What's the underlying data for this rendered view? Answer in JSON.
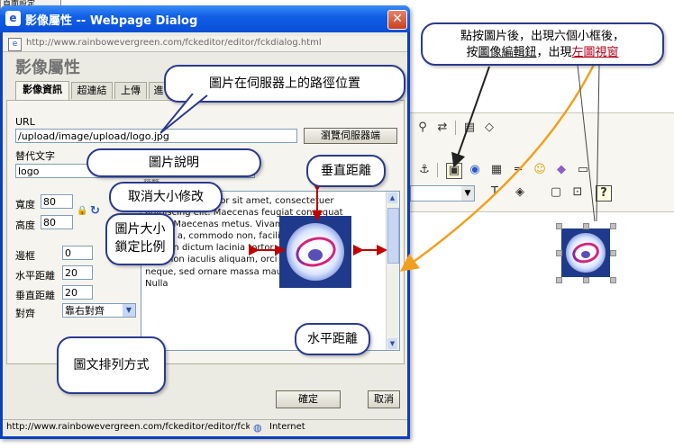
{
  "background": {
    "tab_label": "頁面設定",
    "toolbar_row1_icons": [
      "binoculars-icon",
      "replace-icon",
      "select-all-icon",
      "eraser-icon"
    ],
    "toolbar_row2_icons": [
      "anchor-icon",
      "image-icon",
      "flash-icon",
      "table-icon",
      "horizontal-rule-icon",
      "smiley-icon",
      "special-char-icon",
      "page-break-icon"
    ],
    "toolbar_row3_icons": [
      "text-color-icon",
      "background-color-icon",
      "maximize-icon",
      "preview-icon",
      "about-icon"
    ]
  },
  "dialog": {
    "title": "影像屬性 -- Webpage Dialog",
    "close_glyph": "✕",
    "address": "http://www.rainbowevergreen.com/fckeditor/editor/fckdialog.html",
    "heading": "影像屬性",
    "tabs": [
      "影像資訊",
      "超連結",
      "上傳",
      "進"
    ],
    "url_label": "URL",
    "url_value": "/upload/image/upload/logo.jpg",
    "browse_button": "瀏覽伺服器端",
    "alt_label": "替代文字",
    "alt_value": "logo",
    "width_label": "寬度",
    "width_value": "80",
    "height_label": "高度",
    "height_value": "80",
    "border_label": "邊框",
    "border_value": "0",
    "hspace_label": "水平距離",
    "hspace_value": "20",
    "vspace_label": "垂直距離",
    "vspace_value": "20",
    "align_label": "對齊",
    "align_value": "靠右對齊",
    "preview_label": "預覽",
    "preview_text": "Lorem ipsum dolor sit amet, consectetuer adipiscing elit. Maecenas feugiat consequat diam. Maecenas metus. Vivamus diam purus, cursus a, commodo non, facilisis vitae, nulla. Aenean dictum lacinia tortor. Nunc iaculis, nibh non iaculis aliquam, orci felis euismod neque, sed ornare massa mauris sed velit. Nulla",
    "ok_button": "確定",
    "cancel_button": "取消",
    "status_url": "http://www.rainbowevergreen.com/fckeditor/editor/fckd",
    "status_zone": "Internet"
  },
  "callouts": {
    "path": "圖片在伺服器上的路徑位置",
    "alt": "圖片說明",
    "reset_size": "取消大小修改",
    "lock_ratio": "圖片大小\n鎖定比例",
    "align": "圖文排列方式",
    "vspace": "垂直距離",
    "hspace": "水平距離",
    "top_right_line1": "點按圖片後，出現六個小框後，",
    "top_right_line2_a": "按",
    "top_right_line2_b": "圖像編輯鈕",
    "top_right_line2_c": "，出現",
    "top_right_line2_d": "左圖視窗"
  },
  "colors": {
    "title_bar": "#1160e8",
    "callout_border": "#2b3a8c",
    "red_arrow": "#c00000",
    "orange_arrow": "#f0a020",
    "highlight_text": "#b2001b"
  }
}
